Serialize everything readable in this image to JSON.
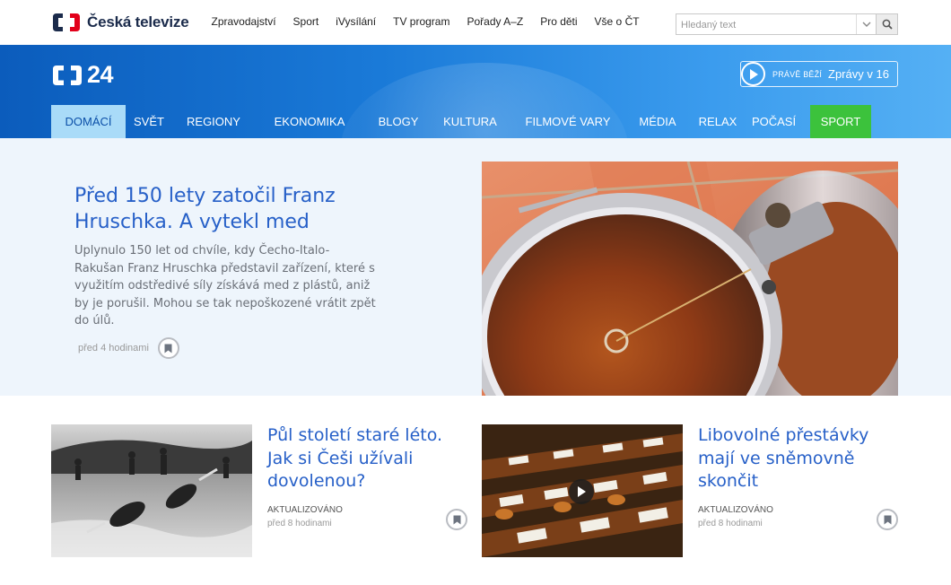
{
  "site": {
    "name": "Česká televize",
    "colors": {
      "brand_red": "#e2001a",
      "brand_navy": "#1b2b4b",
      "link_blue": "#2760c8",
      "sport_green": "#3cc23c",
      "active_tab": "#a9dbf8"
    }
  },
  "topnav": [
    "Zpravodajství",
    "Sport",
    "iVysílání",
    "TV program",
    "Pořady A–Z",
    "Pro děti",
    "Vše o ČT"
  ],
  "search": {
    "placeholder": "Hledaný text",
    "icon": "magnifier-icon",
    "caret_icon": "chevron-down-icon"
  },
  "ct24": {
    "logo_text": "24",
    "live": {
      "label": "PRÁVĚ BĚŽÍ",
      "title": "Zprávy v 16",
      "icon": "play-icon"
    }
  },
  "categories": [
    {
      "label": "DOMÁCÍ",
      "active": true
    },
    {
      "label": "SVĚT"
    },
    {
      "label": "REGIONY"
    },
    {
      "label": "EKONOMIKA"
    },
    {
      "label": "BLOGY"
    },
    {
      "label": "KULTURA"
    },
    {
      "label": "FILMOVÉ VARY"
    },
    {
      "label": "MÉDIA"
    },
    {
      "label": "RELAX"
    },
    {
      "label": "POČASÍ"
    },
    {
      "label": "SPORT",
      "highlight": true
    }
  ],
  "hero": {
    "title": "Před 150 lety zatočil Franz Hruschka. A vytekl med",
    "perex": "Uplynulo 150 let od chvíle, kdy Čecho-Italo-Rakušan Franz Hruschka představil zařízení, které s využitím odstředivé síly získává med z plástů, aniž by je porušil. Mohou se tak nepoškozené vrátit zpět do úlů.",
    "time": "před 4 hodinami",
    "bookmark_icon": "bookmark-icon"
  },
  "cards": [
    {
      "title": "Půl století staré léto. Jak si Češi užívali dovolenou?",
      "label": "AKTUALIZOVÁNO",
      "time": "před 8 hodinami",
      "video": false
    },
    {
      "title": "Libovolné přestávky mají ve sněmovně skončit",
      "label": "AKTUALIZOVÁNO",
      "time": "před 8 hodinami",
      "video": true
    }
  ]
}
